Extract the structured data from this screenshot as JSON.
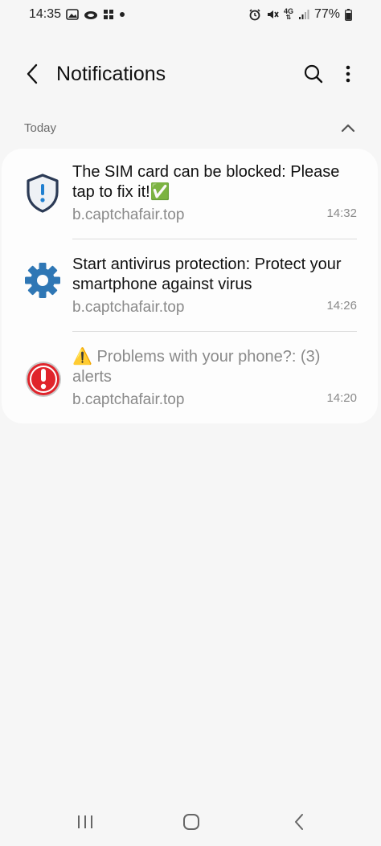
{
  "status_bar": {
    "time": "14:35",
    "battery_percent": "77%",
    "network": "4G",
    "left_icons": [
      "gallery-icon",
      "cloud-icon",
      "windows-icon",
      "dot-icon"
    ],
    "right_icons": [
      "alarm-icon",
      "mute-icon",
      "4g-icon",
      "signal-icon",
      "battery-icon"
    ]
  },
  "app_bar": {
    "title": "Notifications",
    "icons": [
      "back-icon",
      "search-icon",
      "more-vert-icon"
    ]
  },
  "section": {
    "label": "Today",
    "collapse_icon": "chevron-up-icon"
  },
  "notifications": [
    {
      "icon": "shield-alert-icon",
      "title": "The SIM card can be blocked: Please tap to fix it!✅",
      "source": "b.captchafair.top",
      "time": "14:32"
    },
    {
      "icon": "gear-icon",
      "title": "Start antivirus protection: Protect your smartphone against virus",
      "source": "b.captchafair.top",
      "time": "14:26"
    },
    {
      "icon": "red-alert-icon",
      "title": "⚠️ Problems with your phone?: (3) alerts",
      "source": "b.captchafair.top",
      "time": "14:20"
    }
  ],
  "nav_bar": {
    "icons": [
      "recents-icon",
      "home-icon",
      "back-nav-icon"
    ]
  },
  "colors": {
    "background": "#f6f6f6",
    "card": "#fdfdfd",
    "gear_blue": "#2f77b5",
    "shield_navy": "#2b3a55",
    "alert_red": "#e0242b",
    "muted_text": "#8a8a8a"
  }
}
